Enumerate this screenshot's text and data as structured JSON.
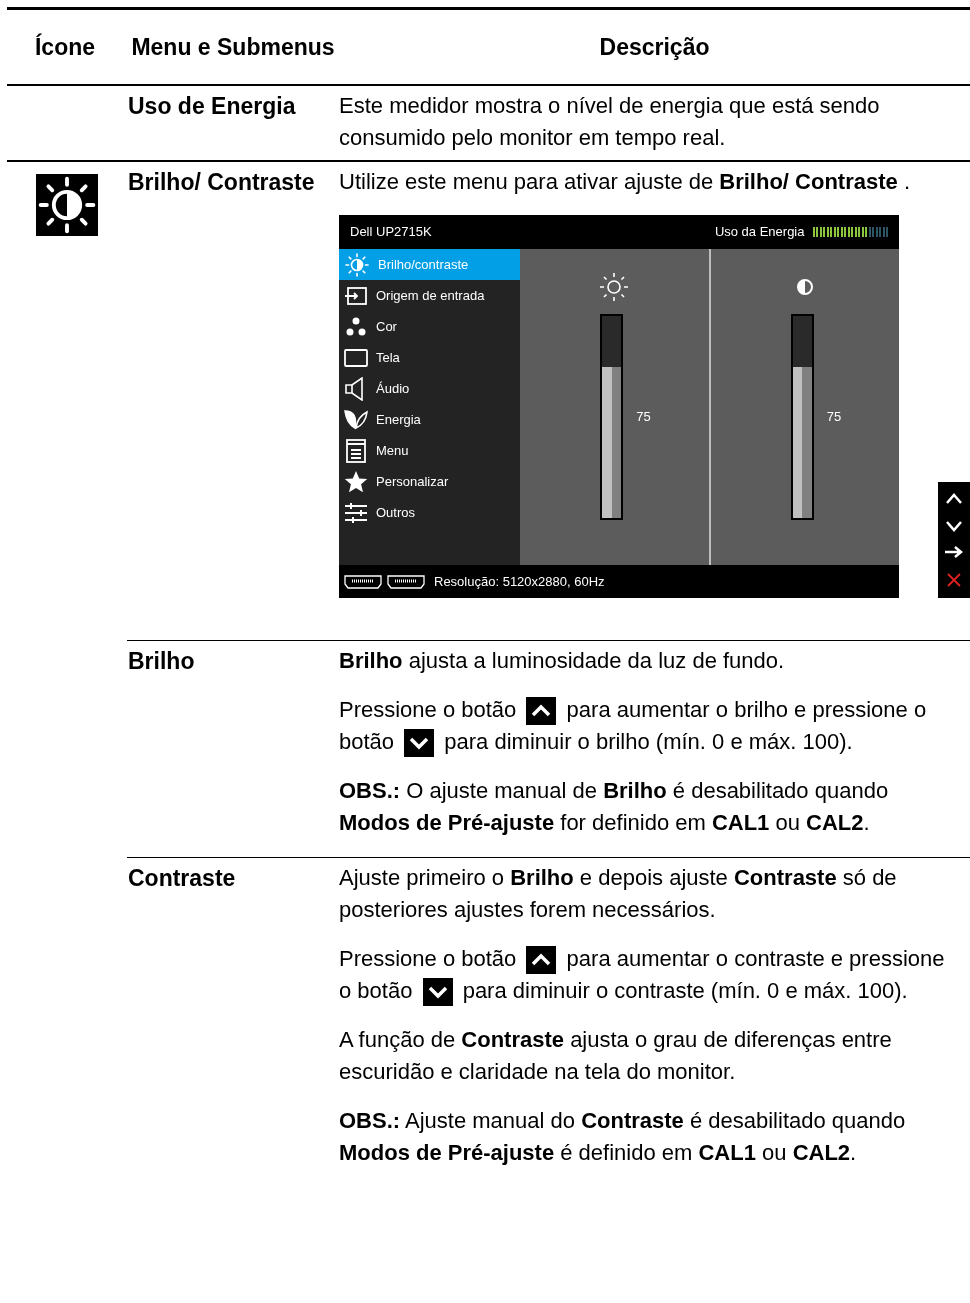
{
  "table": {
    "columns": [
      "Ícone",
      "Menu e Submenus",
      "Descrição"
    ],
    "rows": [
      {
        "menu": "Uso de Energia",
        "has_icon": false,
        "sub": false,
        "paragraphs": [
          [
            {
              "kind": "text",
              "text": "Este medidor mostra o nível de energia que está sendo consumido pelo monitor em tempo real."
            }
          ]
        ]
      },
      {
        "menu": "Brilho/ Contraste",
        "has_icon": true,
        "sub": false,
        "paragraphs": [
          [
            {
              "kind": "text",
              "text": "Utilize este menu para ativar ajuste de **Brilho/ Contraste** ."
            }
          ]
        ],
        "osd": {
          "model": "Dell UP2715K",
          "energy_label": "Uso da Energia",
          "energy": {
            "level": 0.73
          },
          "menu": [
            {
              "label": "Brilho/contraste",
              "selected": true
            },
            {
              "label": "Origem de entrada",
              "selected": false
            },
            {
              "label": "Cor",
              "selected": false
            },
            {
              "label": "Tela",
              "selected": false
            },
            {
              "label": "Áudio",
              "selected": false
            },
            {
              "label": "Energia",
              "selected": false
            },
            {
              "label": "Menu",
              "selected": false
            },
            {
              "label": "Personalizar",
              "selected": false
            },
            {
              "label": "Outros",
              "selected": false
            }
          ],
          "panels": [
            {
              "level": 0.75,
              "value": "75"
            },
            {
              "level": 0.75,
              "value": "75"
            }
          ],
          "footer": "Resolução: 5120x2880, 60Hz"
        }
      },
      {
        "menu": "Brilho",
        "has_icon": false,
        "sub": true,
        "paragraphs": [
          [
            {
              "kind": "text",
              "text": "**Brilho** ajusta a luminosidade da luz de fundo."
            }
          ],
          [
            {
              "kind": "text",
              "text": "Pressione o botão"
            },
            {
              "kind": "up_key"
            },
            {
              "kind": "text",
              "text": "para aumentar o brilho e pressione o botão"
            },
            {
              "kind": "down_key"
            },
            {
              "kind": "text",
              "text": "para diminuir o brilho (mín. 0 e máx. 100)."
            }
          ],
          [
            {
              "kind": "text",
              "text": "**OBS.:** O ajuste manual de **Brilho** é desabilitado quando **Modos de Pré-ajuste** for definido em **CAL1** ou **CAL2**."
            }
          ]
        ]
      },
      {
        "menu": "Contraste",
        "has_icon": false,
        "sub": true,
        "paragraphs": [
          [
            {
              "kind": "text",
              "text": "Ajuste primeiro o **Brilho** e depois ajuste **Contraste** só de posteriores ajustes forem necessários."
            }
          ],
          [
            {
              "kind": "text",
              "text": "Pressione o botão"
            },
            {
              "kind": "up_key"
            },
            {
              "kind": "text",
              "text": "para aumentar o contraste e pressione o botão"
            },
            {
              "kind": "down_key"
            },
            {
              "kind": "text",
              "text": "para diminuir o contraste (mín. 0 e máx. 100)."
            }
          ],
          [
            {
              "kind": "text",
              "text": "A função de **Contraste** ajusta o grau de diferenças entre escuridão e claridade na tela do monitor."
            }
          ],
          [
            {
              "kind": "text",
              "text": "**OBS.:** Ajuste manual do **Contraste** é desabilitado quando **Modos de Pré-ajuste** é definido em **CAL1** ou **CAL2**."
            }
          ]
        ]
      }
    ]
  }
}
